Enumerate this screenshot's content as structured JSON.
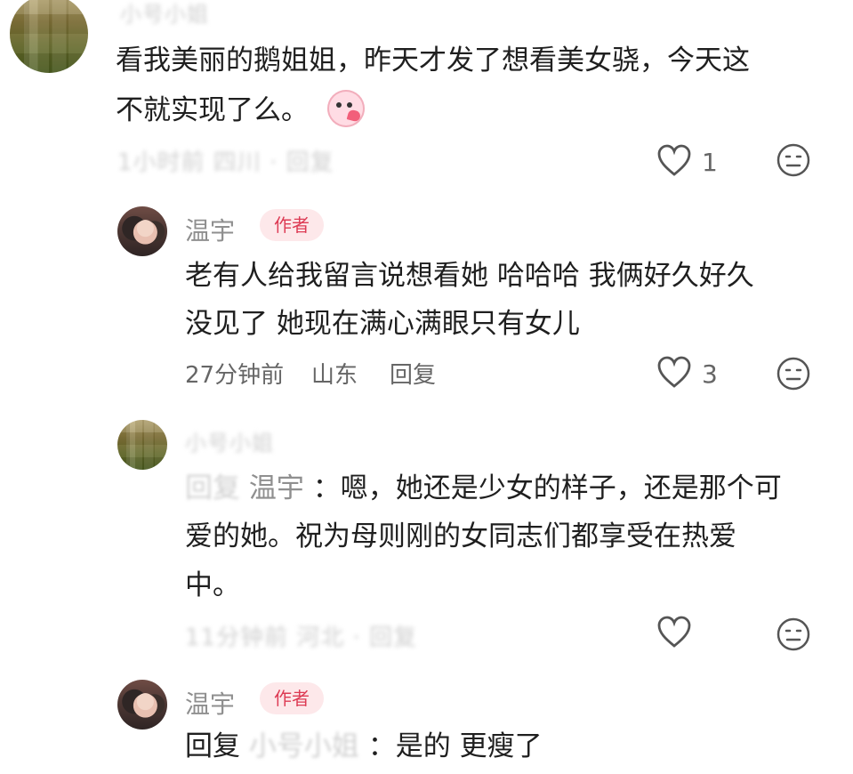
{
  "comments": {
    "c1": {
      "username": "小号小姐",
      "text_line1": "看我美丽的鹅姐姐，昨天才发了想看美女骁，今天这",
      "text_line2": "不就实现了么。",
      "meta": "1小时前 四川 · 回复",
      "likes": "1"
    },
    "r1": {
      "username": "温宇",
      "badge": "作者",
      "text_line1": "老有人给我留言说想看她 哈哈哈 我俩好久好久",
      "text_line2": "没见了 她现在满心满眼只有女儿",
      "time": "27分钟前",
      "location": "山东",
      "reply": "回复",
      "likes": "3"
    },
    "r2": {
      "username": "小号小姐",
      "reply_prefix": "回复",
      "reply_target": "温宇",
      "text_line1": "：嗯，她还是少女的样子，还是那个可",
      "text_line2": "爱的她。祝为母则刚的女同志们都享受在热爱",
      "text_line3": "中。",
      "meta": "11分钟前 河北 · 回复"
    },
    "r3": {
      "username": "温宇",
      "badge": "作者",
      "reply_prefix": "回复",
      "reply_target": "小号小姐",
      "text": "：是的 更瘦了"
    }
  },
  "icons": {
    "heart": "heart-outline-icon",
    "dislike": "neutral-face-icon",
    "emoji": "blush-emoji-icon"
  }
}
